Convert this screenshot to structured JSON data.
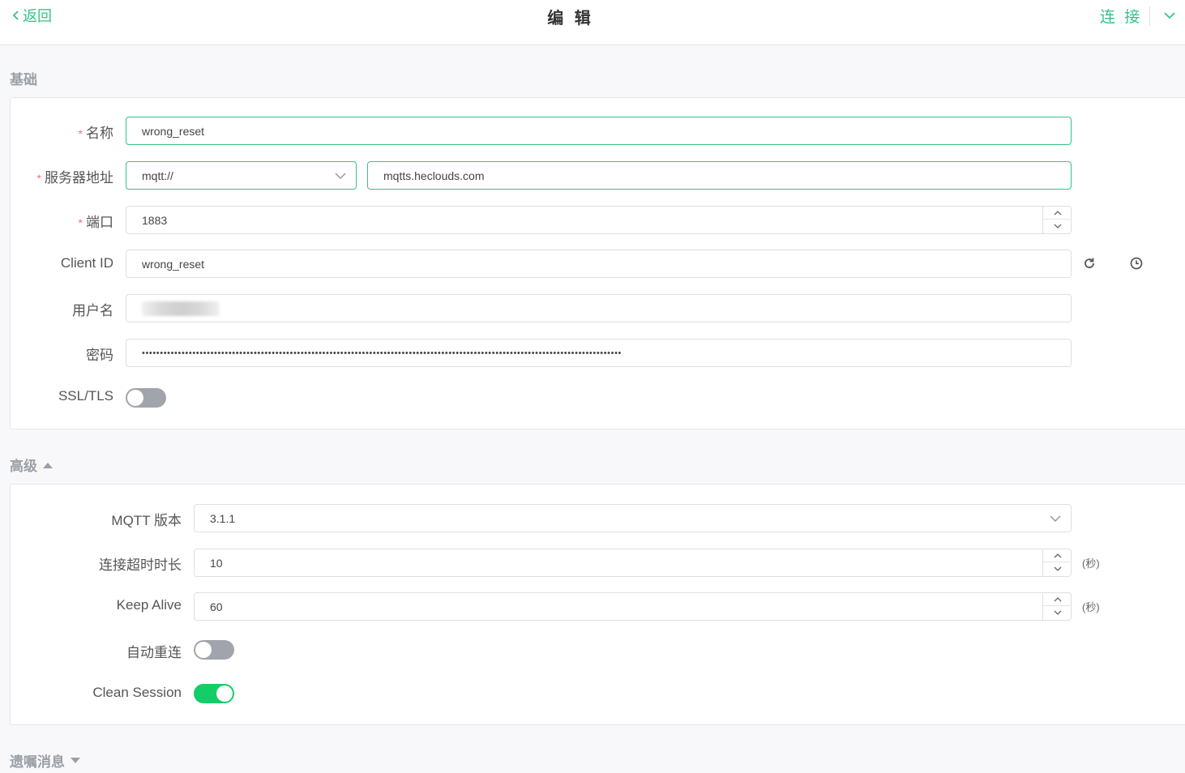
{
  "header": {
    "back_label": "返回",
    "title": "编 辑",
    "connect_label": "连 接"
  },
  "basic": {
    "section_title": "基础",
    "name_label": "名称",
    "name_value": "wrong_reset",
    "server_label": "服务器地址",
    "protocol_value": "mqtt://",
    "host_value": "mqtts.heclouds.com",
    "port_label": "端口",
    "port_value": "1883",
    "client_id_label": "Client ID",
    "client_id_value": "wrong_reset",
    "username_label": "用户名",
    "password_label": "密码",
    "password_dots": "•••••••••••••••••••••••••••••••••••••••••••••••••••••••••••••••••••••••••••••••••••••••••••••••••••••••••••••••••••••••••••••••••••••",
    "ssl_label": "SSL/TLS",
    "ssl_on": false
  },
  "advanced": {
    "section_title": "高级",
    "mqtt_version_label": "MQTT 版本",
    "mqtt_version_value": "3.1.1",
    "timeout_label": "连接超时时长",
    "timeout_value": "10",
    "timeout_unit": "(秒)",
    "keepalive_label": "Keep Alive",
    "keepalive_value": "60",
    "keepalive_unit": "(秒)",
    "auto_reconnect_label": "自动重连",
    "auto_reconnect_on": false,
    "clean_session_label": "Clean Session",
    "clean_session_on": true
  },
  "will": {
    "section_title": "遗嘱消息"
  },
  "colors": {
    "accent": "#34c388",
    "required": "#f56c6c",
    "toggle_on": "#13ce66",
    "toggle_off": "#a0a4ab"
  }
}
